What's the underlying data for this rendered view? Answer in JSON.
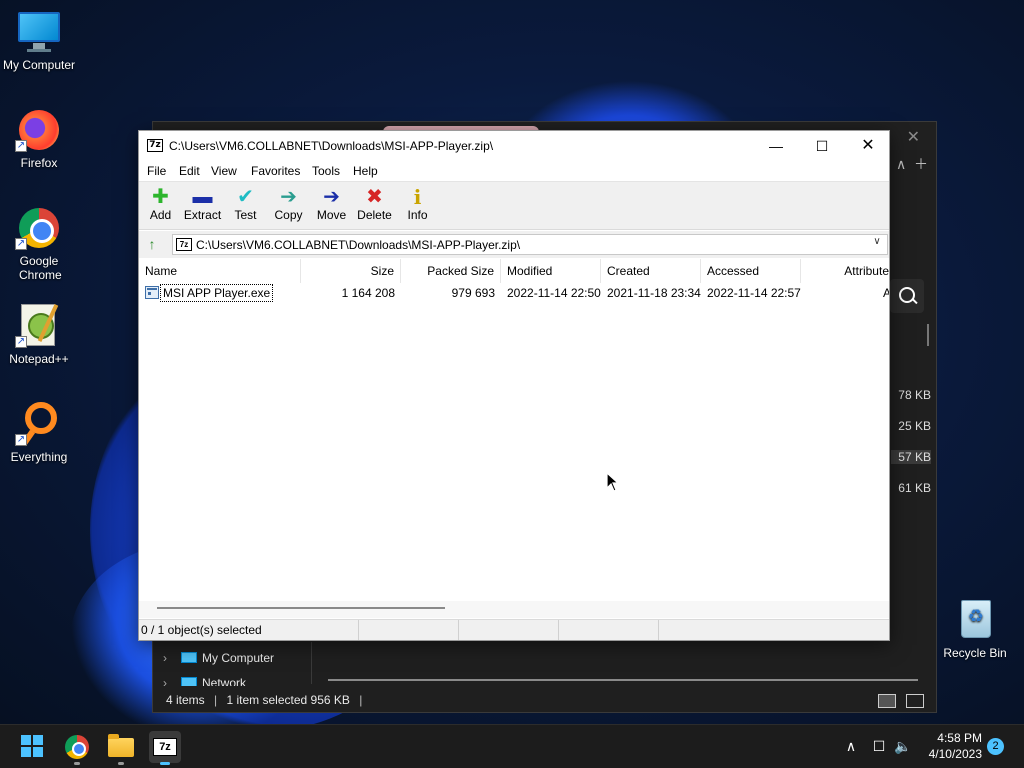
{
  "desktop": {
    "icons": [
      {
        "label": "My Computer",
        "icon": "monitor-icon"
      },
      {
        "label": "Firefox",
        "icon": "firefox-icon"
      },
      {
        "label": "Google Chrome",
        "icon": "chrome-icon"
      },
      {
        "label": "Notepad++",
        "icon": "notepadpp-icon"
      },
      {
        "label": "Everything",
        "icon": "everything-icon"
      },
      {
        "label": "Recycle Bin",
        "icon": "recycle-bin-icon"
      }
    ]
  },
  "explorer_bg": {
    "sizes": [
      "78 KB",
      "25 KB",
      "57 KB",
      "61 KB"
    ],
    "selected_size_index": 2,
    "nav": [
      {
        "label": "My Computer",
        "icon": "monitor-icon"
      },
      {
        "label": "Network",
        "icon": "network-icon"
      }
    ],
    "status": {
      "items": "4 items",
      "selection": "1 item selected  956 KB"
    }
  },
  "sevenzip": {
    "logo_text": "7z",
    "title": "C:\\Users\\VM6.COLLABNET\\Downloads\\MSI-APP-Player.zip\\",
    "window_controls": {
      "minimize": "—",
      "maximize": "☐",
      "close": "✕"
    },
    "menu": [
      "File",
      "Edit",
      "View",
      "Favorites",
      "Tools",
      "Help"
    ],
    "toolbar": [
      {
        "label": "Add",
        "glyph": "✚",
        "color": "#2db52d",
        "icon": "add-icon"
      },
      {
        "label": "Extract",
        "glyph": "▬",
        "color": "#1b2fa8",
        "icon": "extract-icon"
      },
      {
        "label": "Test",
        "glyph": "✔",
        "color": "#1fbcc4",
        "icon": "test-icon"
      },
      {
        "label": "Copy",
        "glyph": "➔",
        "color": "#2a9d8f",
        "icon": "copy-icon"
      },
      {
        "label": "Move",
        "glyph": "➔",
        "color": "#1b2fa8",
        "icon": "move-icon"
      },
      {
        "label": "Delete",
        "glyph": "✖",
        "color": "#d62424",
        "icon": "delete-icon"
      },
      {
        "label": "Info",
        "glyph": "i",
        "color": "#c9a400",
        "icon": "info-icon"
      }
    ],
    "address": "C:\\Users\\VM6.COLLABNET\\Downloads\\MSI-APP-Player.zip\\",
    "columns": [
      "Name",
      "Size",
      "Packed Size",
      "Modified",
      "Created",
      "Accessed",
      "Attribute"
    ],
    "rows": [
      {
        "name": "MSI APP Player.exe",
        "size": "1 164 208",
        "packed_size": "979 693",
        "modified": "2022-11-14 22:50",
        "created": "2021-11-18 23:34",
        "accessed": "2022-11-14 22:57",
        "attribute": "A"
      }
    ],
    "status": [
      "0 / 1 object(s) selected",
      "",
      "",
      ""
    ]
  },
  "taskbar": {
    "apps": [
      {
        "name": "Google Chrome",
        "icon": "chrome-icon"
      },
      {
        "name": "File Explorer",
        "icon": "folder-icon"
      },
      {
        "name": "7-Zip",
        "icon": "sevenzip-icon",
        "logo_text": "7z",
        "active": true
      }
    ],
    "tray": {
      "chevron": "∧",
      "network": "☐",
      "volume": "🔈"
    },
    "time": "4:58 PM",
    "date": "4/10/2023",
    "notifications": "2"
  },
  "colors": {
    "accent": "#4cc2ff",
    "wallpaper": "#0a1630",
    "taskbar": "#1c1c1c"
  }
}
